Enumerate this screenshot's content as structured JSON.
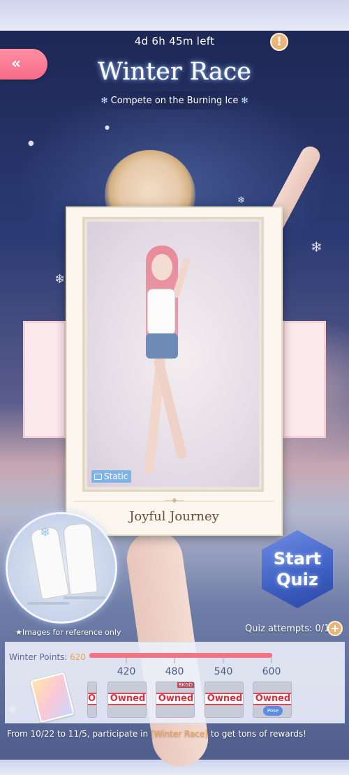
{
  "event": {
    "time_left": "4d 6h 45m left",
    "title": "Winter Race",
    "subtitle": "Compete on the Burning Ice"
  },
  "card": {
    "static_tag": "Static",
    "name": "Joyful Journey"
  },
  "reference_note": "★Images for reference only",
  "quiz": {
    "line1": "Start",
    "line2": "Quiz",
    "attempts": "Quiz attempts: 0/1"
  },
  "points": {
    "label": "Winter Points:",
    "value": "620",
    "progress": 1.0,
    "milestones": [
      "420",
      "480",
      "540",
      "600"
    ]
  },
  "rewards": {
    "owned_label": "Owned",
    "bkgd_tag": "BKGD",
    "pose_tag": "Pose"
  },
  "footer": {
    "prefix": "From 10/22 to 11/5, participate in ",
    "highlight": "[Winter Race]",
    "suffix": " to get tons of rewards!"
  },
  "colors": {
    "accent_pink": "#f76b87",
    "points_orange": "#f0a048",
    "owned_red": "#d8303f"
  },
  "icons": [
    "back-arrow-icon",
    "warning-icon",
    "snowflake-icon",
    "static-camera-icon",
    "plus-icon"
  ]
}
